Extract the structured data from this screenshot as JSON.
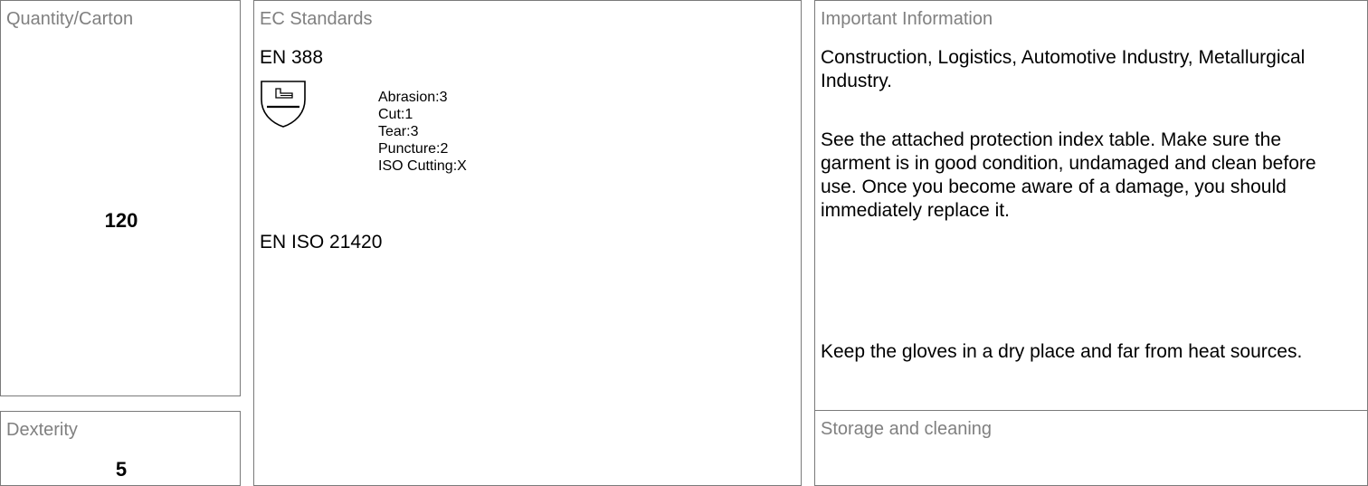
{
  "quantity_carton": {
    "heading": "Quantity/Carton",
    "value": "120"
  },
  "dexterity": {
    "heading": "Dexterity",
    "value": "5"
  },
  "ec_standards": {
    "heading": "EC Standards",
    "standards": [
      {
        "code": "EN 388",
        "icon": "hand-shield-icon",
        "ratings": [
          "Abrasion:3",
          "Cut:1",
          "Tear:3",
          "Puncture:2",
          "ISO Cutting:X"
        ]
      },
      {
        "code": "EN ISO 21420"
      }
    ]
  },
  "important_information": {
    "heading": "Important Information",
    "paragraphs": [
      "Construction, Logistics, Automotive Industry, Metallurgical Industry.",
      "See the attached protection index table. Make sure the garment is in good condition, undamaged and clean before use. Once you become aware of a damage, you should immediately replace it.",
      "Keep the gloves in a dry place and far from heat sources."
    ]
  },
  "storage_cleaning": {
    "heading": "Storage and cleaning"
  }
}
